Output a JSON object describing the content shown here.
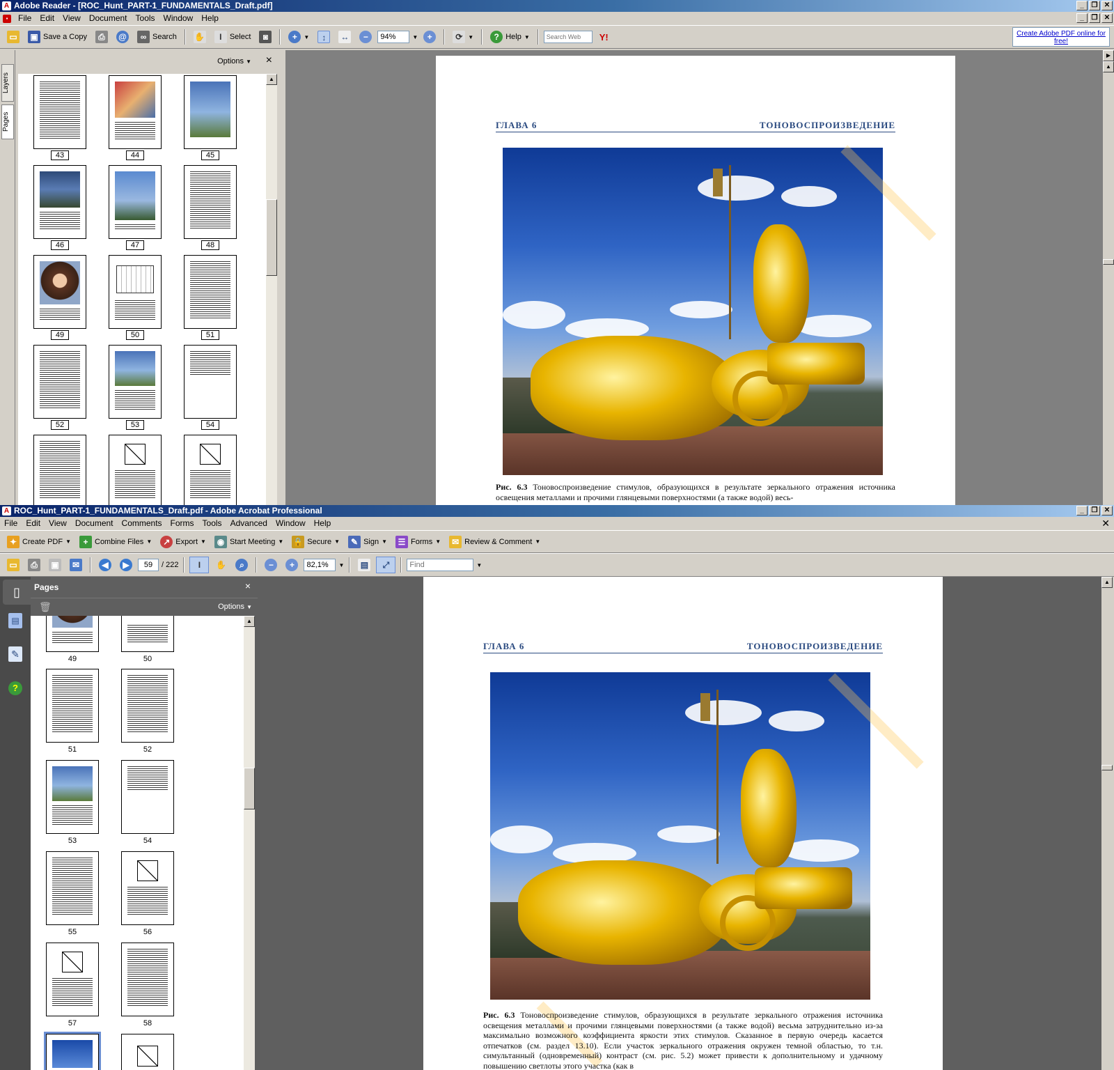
{
  "reader": {
    "title": "Adobe Reader - [ROC_Hunt_PART-1_FUNDAMENTALS_Draft.pdf]",
    "menus": [
      "File",
      "Edit",
      "View",
      "Document",
      "Tools",
      "Window",
      "Help"
    ],
    "toolbar": {
      "save_copy": "Save a Copy",
      "search": "Search",
      "select": "Select",
      "zoom": "94%",
      "help": "Help",
      "search_web_placeholder": "Search Web",
      "yahoo": "Y!",
      "create_pdf": "Create Adobe PDF online for free!"
    },
    "side_tabs": [
      "Layers",
      "Pages"
    ],
    "panel": {
      "options": "Options",
      "close": "×"
    },
    "thumbs": [
      "43",
      "44",
      "45",
      "46",
      "47",
      "48",
      "49",
      "50",
      "51",
      "52",
      "53",
      "54"
    ],
    "page": {
      "header_left": "ГЛАВА 6",
      "header_right": "ТОНОВОСПРОИЗВЕДЕНИЕ",
      "caption_bold": "Рис. 6.3",
      "caption_text": "Тоновоспроизведение стимулов, образующихся в результате зеркального отражения источника освещения металлами и прочими глянцевыми поверхностями (а также водой) весь-"
    }
  },
  "acrobat": {
    "title": "ROC_Hunt_PART-1_FUNDAMENTALS_Draft.pdf - Adobe Acrobat Professional",
    "menus": [
      "File",
      "Edit",
      "View",
      "Document",
      "Comments",
      "Forms",
      "Tools",
      "Advanced",
      "Window",
      "Help"
    ],
    "tasks": [
      "Create PDF",
      "Combine Files",
      "Export",
      "Start Meeting",
      "Secure",
      "Sign",
      "Forms",
      "Review & Comment"
    ],
    "nav": {
      "page": "59",
      "total": "/ 222",
      "zoom": "82,1%",
      "find_placeholder": "Find"
    },
    "panel": {
      "title": "Pages",
      "options": "Options",
      "close": "×"
    },
    "thumbs": [
      "49",
      "50",
      "51",
      "52",
      "53",
      "54",
      "55",
      "56",
      "57",
      "58"
    ],
    "page": {
      "header_left": "ГЛАВА 6",
      "header_right": "ТОНОВОСПРОИЗВЕДЕНИЕ",
      "caption_bold": "Рис. 6.3",
      "caption_text": "Тоновоспроизведение стимулов, образующихся в результате зеркального отражения источника освещения металлами и прочими глянцевыми поверхностями (а также водой) весьма затруднительно из-за максимально возможного коэффициента яркости этих стимулов. Сказанное в первую очередь касается отпечатков (см. раздел 13.10). Если участок зеркального отражения окружен темной областью, то т.н. симультанный (одновременный) контраст (см. рис. 5.2) может привести к дополнительному и удачному повышению светлоты этого участка (как в"
    }
  }
}
